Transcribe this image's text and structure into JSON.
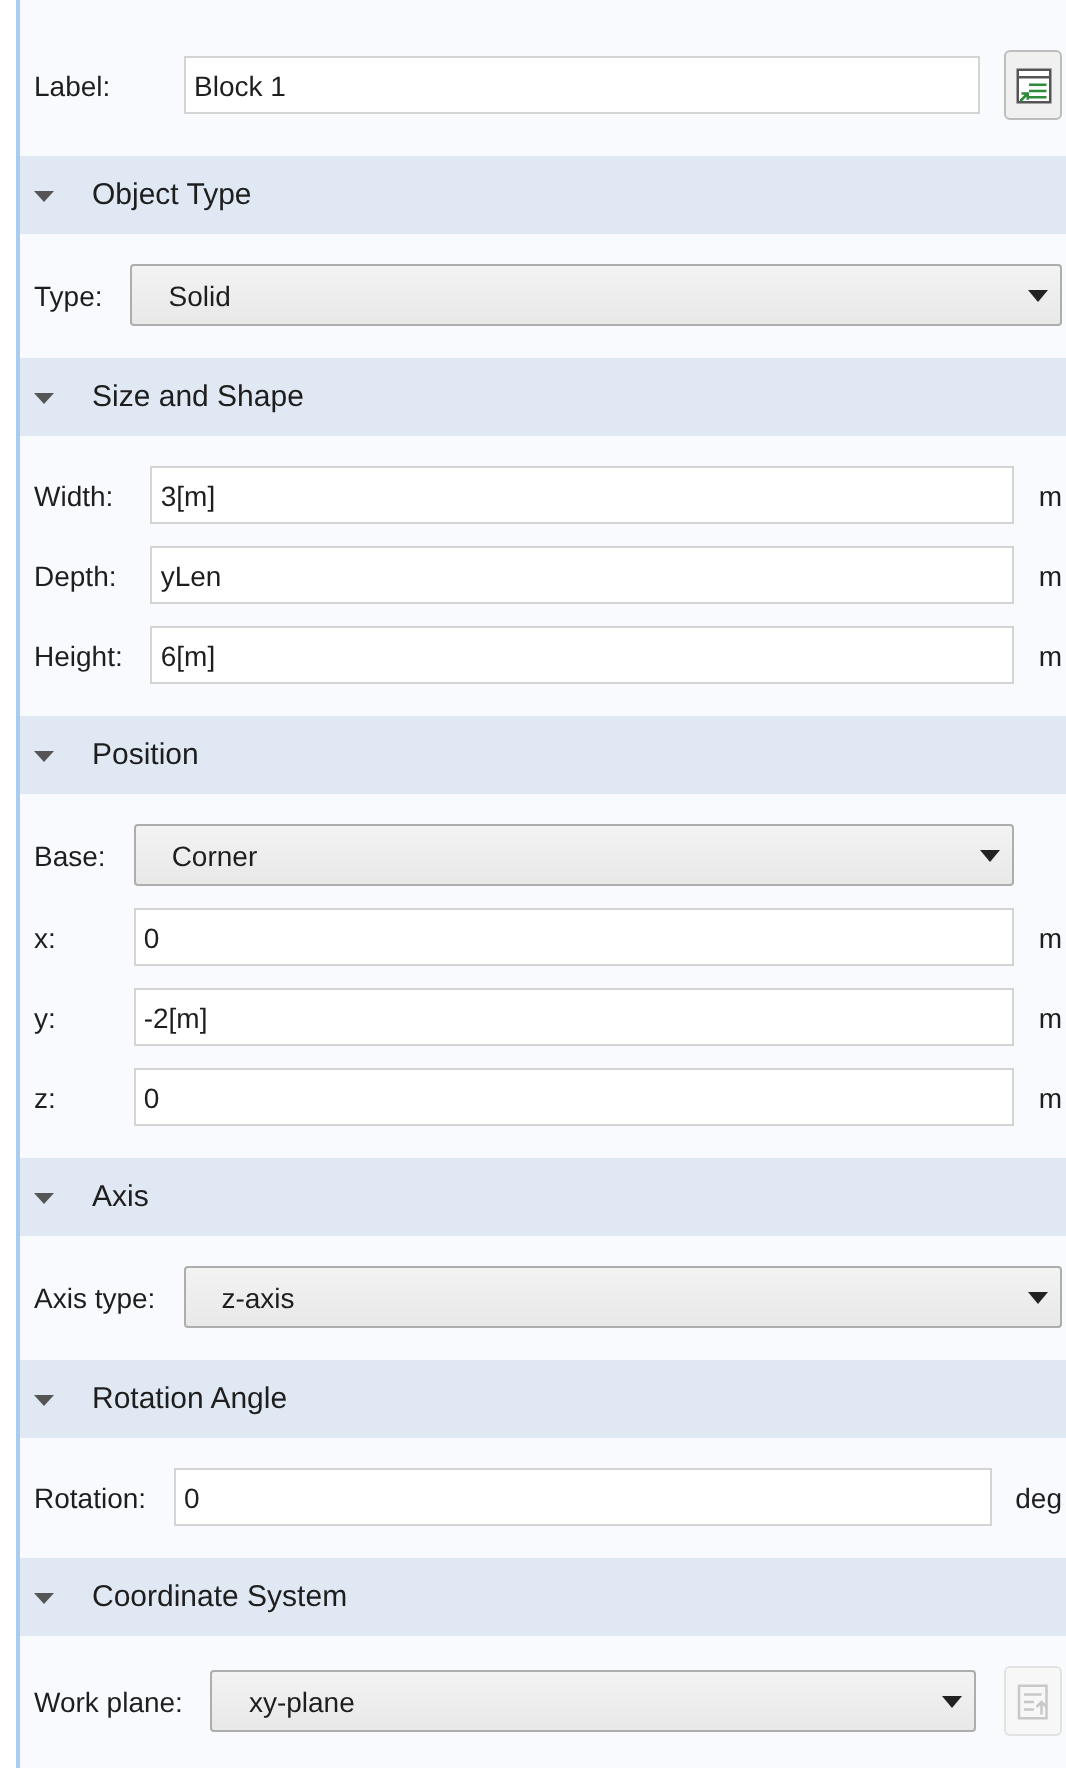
{
  "label_row": {
    "label": "Label:",
    "value": "Block 1",
    "button": {
      "disabled": false
    }
  },
  "sections": [
    {
      "title": "Object Type",
      "expanded": true,
      "rows": [
        {
          "kind": "dropdown",
          "label": "Type:",
          "value": "Solid"
        }
      ]
    },
    {
      "title": "Size and Shape",
      "expanded": true,
      "rows": [
        {
          "kind": "field",
          "label": "Width:",
          "value": "3[m]",
          "unit": "m"
        },
        {
          "kind": "field",
          "label": "Depth:",
          "value": "yLen",
          "unit": "m"
        },
        {
          "kind": "field",
          "label": "Height:",
          "value": "6[m]",
          "unit": "m"
        }
      ]
    },
    {
      "title": "Position",
      "expanded": true,
      "rows": [
        {
          "kind": "dropdown",
          "label": "Base:",
          "value": "Corner"
        },
        {
          "kind": "field",
          "label": "x:",
          "value": "0",
          "unit": "m"
        },
        {
          "kind": "field",
          "label": "y:",
          "value": "-2[m]",
          "unit": "m"
        },
        {
          "kind": "field",
          "label": "z:",
          "value": "0",
          "unit": "m"
        }
      ]
    },
    {
      "title": "Axis",
      "expanded": true,
      "rows": [
        {
          "kind": "dropdown",
          "label": "Axis type:",
          "value": "z-axis"
        }
      ]
    },
    {
      "title": "Rotation Angle",
      "expanded": true,
      "rows": [
        {
          "kind": "field",
          "label": "Rotation:",
          "value": "0",
          "unit": "deg"
        }
      ]
    },
    {
      "title": "Coordinate System",
      "expanded": true,
      "rows": [
        {
          "kind": "dropdown",
          "label": "Work plane:",
          "value": "xy-plane",
          "button": {
            "disabled": true
          }
        }
      ]
    }
  ]
}
